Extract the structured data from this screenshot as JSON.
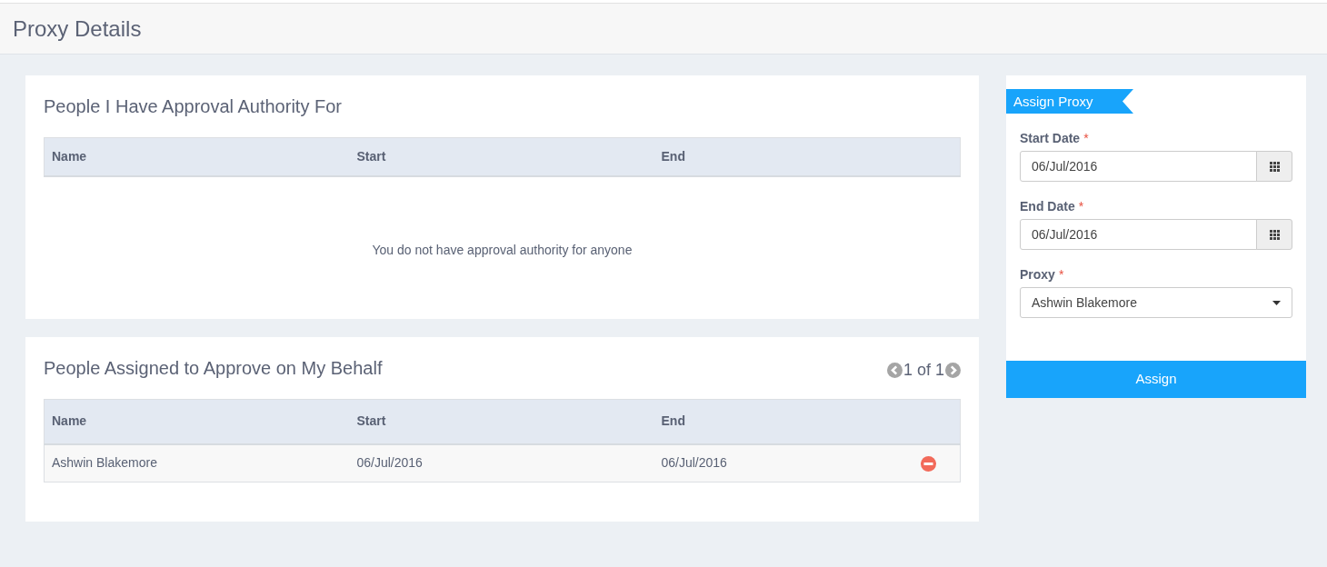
{
  "header": {
    "title": "Proxy Details"
  },
  "authority_panel": {
    "title": "People I Have Approval Authority For",
    "table": {
      "columns": [
        "Name",
        "Start",
        "End"
      ],
      "empty_message": "You do not have approval authority for anyone"
    }
  },
  "delegates_panel": {
    "title": "People Assigned to Approve on My Behalf",
    "pager": {
      "text": "1 of 1"
    },
    "table": {
      "columns": [
        "Name",
        "Start",
        "End"
      ],
      "rows": [
        {
          "cells": [
            "Ashwin Blakemore",
            "06/Jul/2016",
            "06/Jul/2016"
          ],
          "removable": true
        }
      ]
    }
  },
  "assign_form": {
    "ribbon": "Assign Proxy",
    "fields": [
      {
        "kind": "date",
        "label": "Start Date",
        "required_mark": "*",
        "value": "06/Jul/2016"
      },
      {
        "kind": "date",
        "label": "End Date",
        "required_mark": "*",
        "value": "06/Jul/2016"
      },
      {
        "kind": "select",
        "label": "Proxy",
        "required_mark": "*",
        "value": "Ashwin Blakemore"
      }
    ],
    "submit": "Assign"
  }
}
